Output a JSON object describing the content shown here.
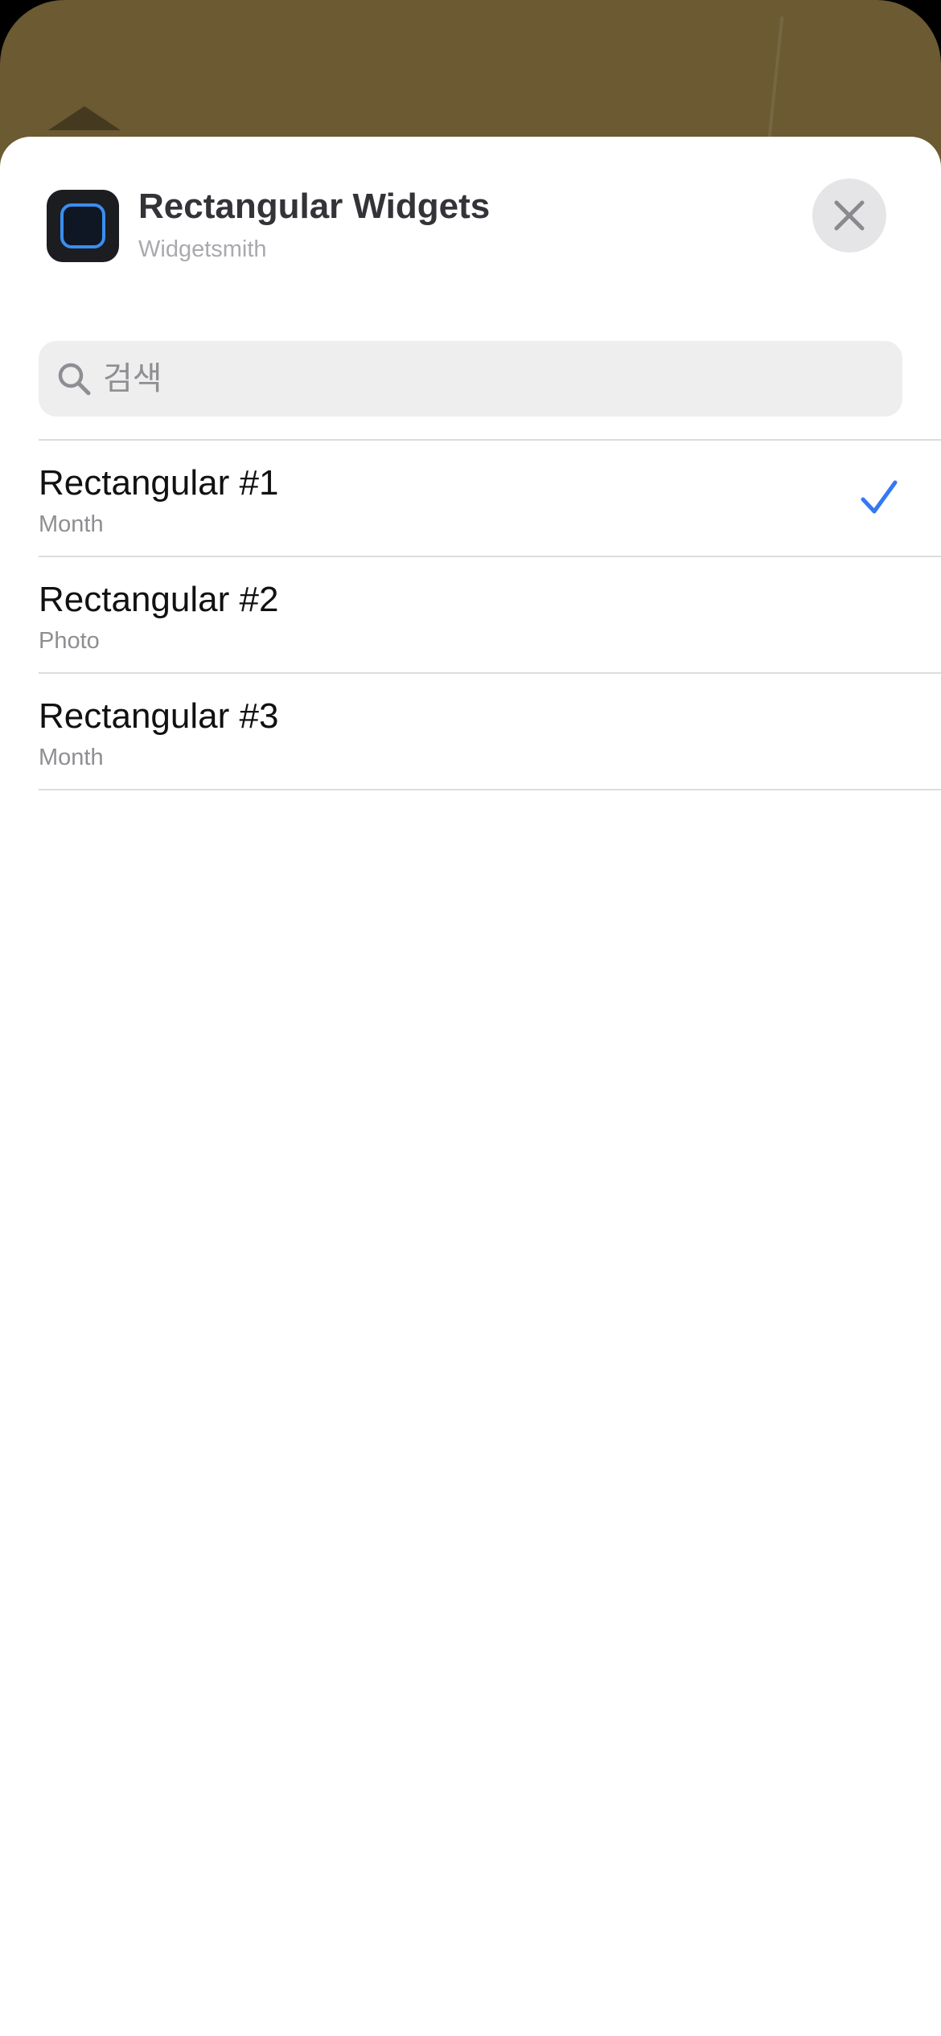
{
  "header": {
    "title": "Rectangular Widgets",
    "subtitle": "Widgetsmith"
  },
  "search": {
    "placeholder": "검색",
    "value": ""
  },
  "items": [
    {
      "title": "Rectangular #1",
      "subtitle": "Month",
      "selected": true
    },
    {
      "title": "Rectangular #2",
      "subtitle": "Photo",
      "selected": false
    },
    {
      "title": "Rectangular #3",
      "subtitle": "Month",
      "selected": false
    }
  ],
  "icons": {
    "app": "widgetsmith-app-icon",
    "close": "close-icon",
    "search": "search-icon",
    "check": "checkmark-icon"
  },
  "colors": {
    "accent": "#3478f6",
    "sheet_background": "#ffffff",
    "wallpaper": "#6b5a32"
  }
}
